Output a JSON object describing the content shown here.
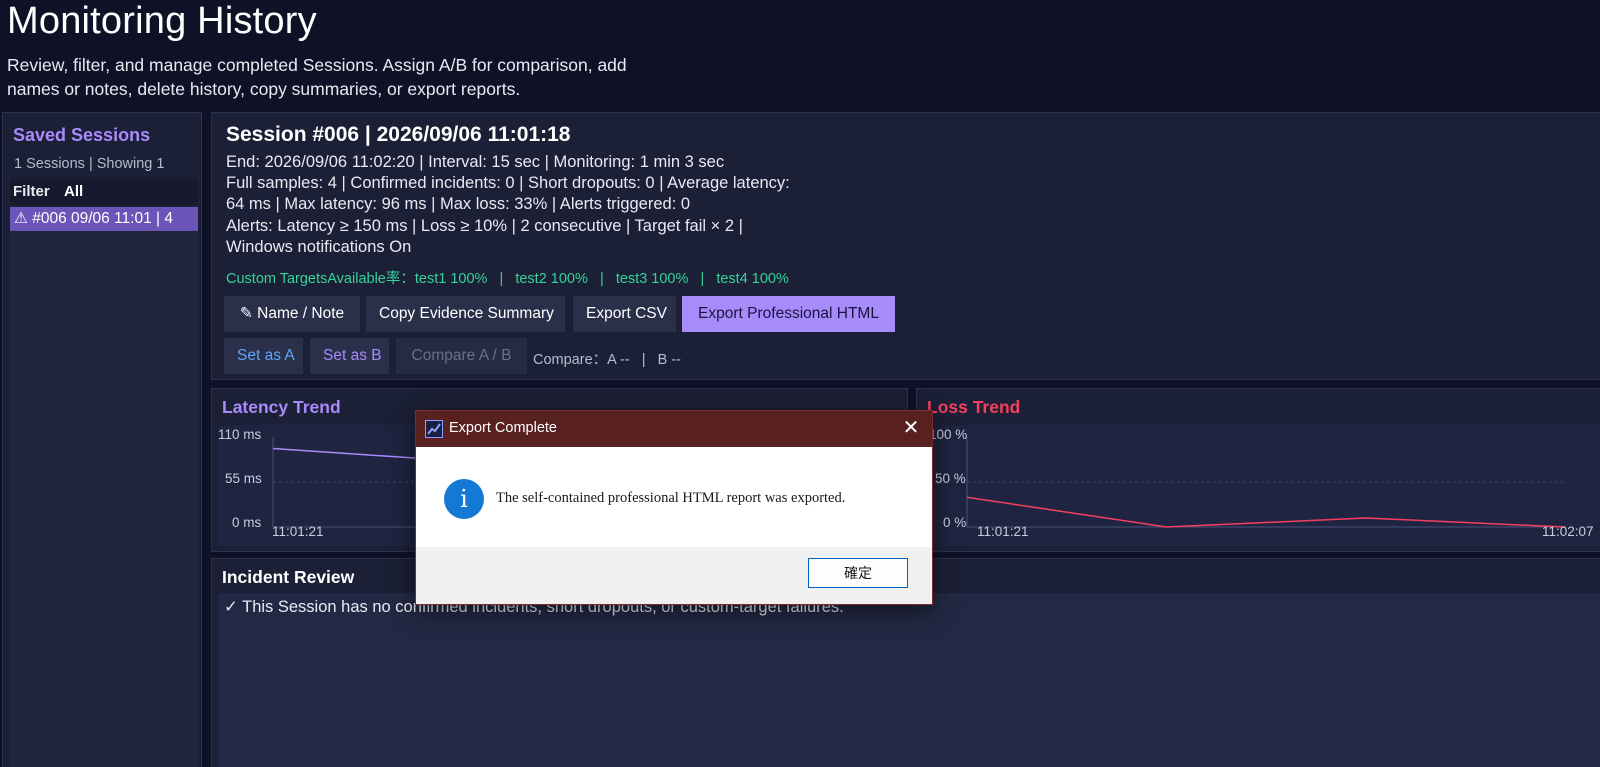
{
  "header": {
    "title": "Monitoring History",
    "subtitle_line1": "Review, filter, and manage completed Sessions. Assign A/B for comparison, add",
    "subtitle_line2": "names or notes, delete history, copy summaries, or export reports."
  },
  "sidebar": {
    "title": "Saved Sessions",
    "count": "1 Sessions | Showing 1",
    "filter_label": "Filter",
    "filter_value": "All",
    "items": [
      {
        "label": "⚠ #006  09/06 11:01  |  4"
      }
    ]
  },
  "session": {
    "title": "Session #006 | 2026/09/06 11:01:18",
    "line1": "End: 2026/09/06 11:02:20 | Interval: 15 sec | Monitoring: 1 min 3 sec",
    "line2": "Full samples: 4 | Confirmed incidents: 0 | Short dropouts: 0 | Average latency:",
    "line3": "64 ms | Max latency: 96 ms | Max loss: 33% | Alerts triggered: 0",
    "line4": "Alerts: Latency ≥ 150 ms | Loss ≥ 10% | 2 consecutive | Target fail × 2 |",
    "line5": "Windows notifications On",
    "custom_targets": "Custom TargetsAvailable率：test1 100%   |   test2 100%   |   test3 100%   |   test4 100%"
  },
  "toolbar": {
    "name_note": "✎ Name / Note",
    "copy_summary": "Copy Evidence Summary",
    "export_csv": "Export CSV",
    "export_html": "Export Professional HTML",
    "set_a": "Set as A",
    "set_b": "Set as B",
    "compare": "Compare A / B",
    "compare_status": "Compare：A --   |   B --"
  },
  "latency_chart": {
    "title": "Latency Trend",
    "color": "#a78bfa",
    "y_ticks": [
      "110 ms",
      "55 ms",
      "0 ms"
    ],
    "x_start": "11:01:21"
  },
  "loss_chart": {
    "title": "Loss Trend",
    "color": "#f43f5e",
    "y_ticks": [
      "100 %",
      "50 %",
      "0 %"
    ],
    "x_start": "11:01:21",
    "x_end": "11:02:07"
  },
  "chart_data": [
    {
      "type": "line",
      "title": "Latency Trend",
      "ylim": [
        0,
        110
      ],
      "series": [
        {
          "points": [
            [
              0,
              96
            ],
            [
              1,
              84
            ]
          ]
        }
      ]
    },
    {
      "type": "line",
      "title": "Loss Trend",
      "ylim": [
        0,
        100
      ],
      "series": [
        {
          "points": [
            [
              0,
              33
            ],
            [
              1,
              0
            ],
            [
              2,
              10
            ],
            [
              3,
              0
            ]
          ]
        }
      ]
    }
  ],
  "incidents": {
    "title": "Incident Review",
    "text": "✓ This Session has no confirmed incidents, short dropouts, or custom-target failures."
  },
  "dialog": {
    "title": "Export Complete",
    "close": "✕",
    "icon": "i",
    "message": "The self-contained professional HTML report was exported.",
    "ok": "確定"
  }
}
